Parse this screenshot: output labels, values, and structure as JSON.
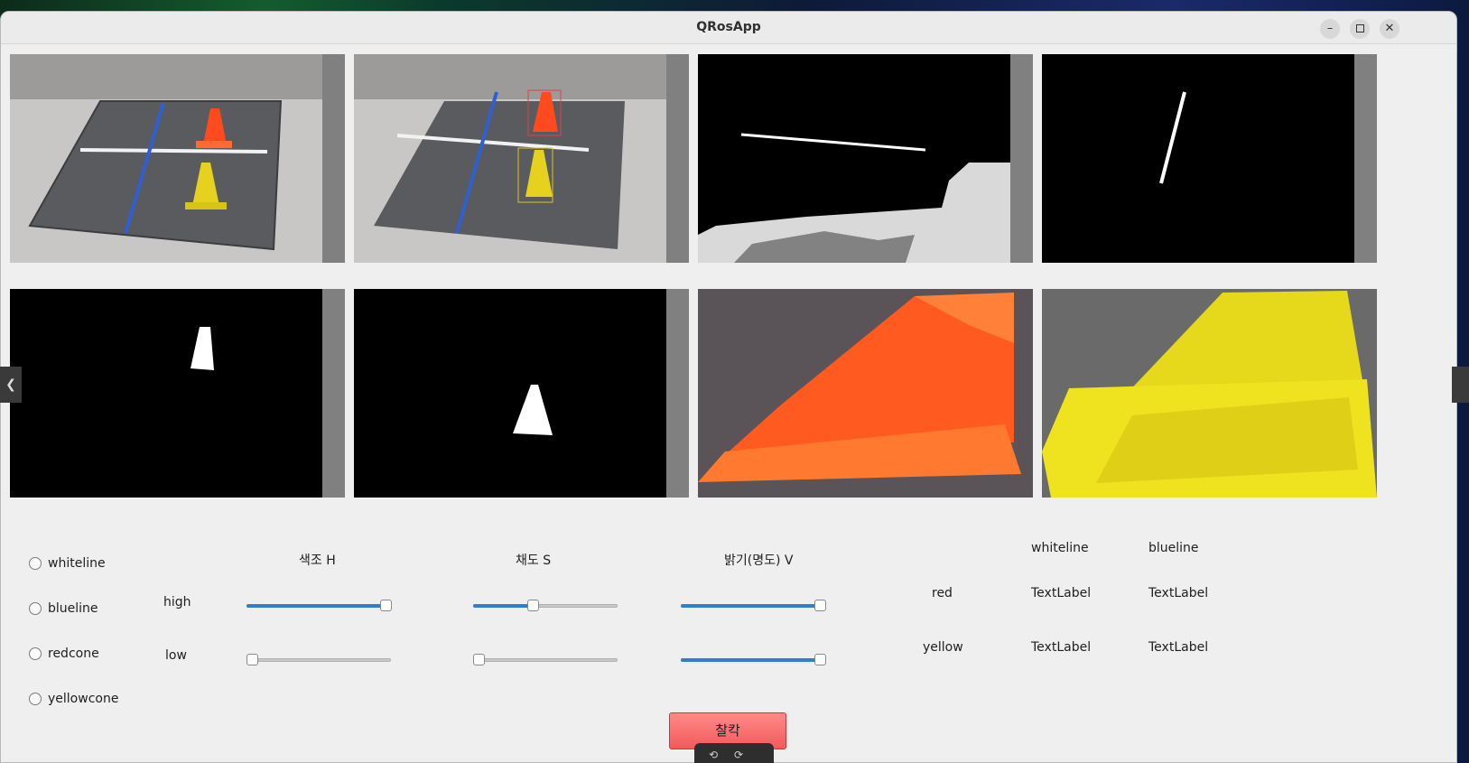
{
  "window": {
    "title": "QRosApp",
    "minimize_icon": "minimize-icon",
    "maximize_icon": "maximize-icon",
    "close_icon": "close-icon"
  },
  "panels": [
    {
      "name": "original-camera-view",
      "content": "color-camera-frame"
    },
    {
      "name": "detection-overlay-view",
      "content": "color-camera-frame-with-boxes"
    },
    {
      "name": "whiteline-mask-view",
      "content": "binary-mask"
    },
    {
      "name": "blueline-mask-view",
      "content": "binary-mask"
    },
    {
      "name": "redcone-mask-view",
      "content": "binary-mask"
    },
    {
      "name": "yellowcone-mask-view",
      "content": "binary-mask"
    },
    {
      "name": "redcone-crop-view",
      "content": "color-crop"
    },
    {
      "name": "yellowcone-crop-view",
      "content": "color-crop"
    }
  ],
  "targets": [
    {
      "label": "whiteline",
      "selected": false
    },
    {
      "label": "blueline",
      "selected": false
    },
    {
      "label": "redcone",
      "selected": false
    },
    {
      "label": "yellowcone",
      "selected": false
    }
  ],
  "hsv": {
    "h_header": "색조 H",
    "s_header": "채도 S",
    "v_header": "밝기(명도) V",
    "high_label": "high",
    "low_label": "low",
    "values": {
      "h_high": 0.96,
      "h_low": 0.04,
      "s_high": 0.41,
      "s_low": 0.04,
      "v_high": 0.96,
      "v_low": 0.96
    }
  },
  "results": {
    "col_whiteline": "whiteline",
    "col_blueline": "blueline",
    "row_red": "red",
    "row_yellow": "yellow",
    "red_whiteline": "TextLabel",
    "red_blueline": "TextLabel",
    "yellow_whiteline": "TextLabel",
    "yellow_blueline": "TextLabel"
  },
  "capture_button": "찰칵",
  "side_tab_left": "❮",
  "bottom_tool": "⟲⟳",
  "colors": {
    "accent": "#2e7fd0",
    "capture": "#f25a5a"
  }
}
